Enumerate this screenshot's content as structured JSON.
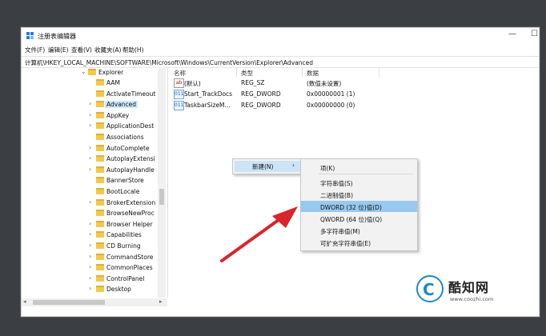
{
  "window": {
    "title": "注册表编辑器",
    "controls": {
      "minimize": "—",
      "maximize": "☐"
    }
  },
  "menubar": [
    "文件(F)",
    "编辑(E)",
    "查看(V)",
    "收藏夹(A)",
    "帮助(H)"
  ],
  "address": "计算机\\HKEY_LOCAL_MACHINE\\SOFTWARE\\Microsoft\\Windows\\CurrentVersion\\Explorer\\Advanced",
  "tree": {
    "parent": "Explorer",
    "items": [
      {
        "label": "AAM",
        "expandable": false
      },
      {
        "label": "ActivateTimeout",
        "expandable": false
      },
      {
        "label": "Advanced",
        "expandable": true,
        "selected": true
      },
      {
        "label": "AppKey",
        "expandable": true
      },
      {
        "label": "ApplicationDest",
        "expandable": true
      },
      {
        "label": "Associations",
        "expandable": false
      },
      {
        "label": "AutoComplete",
        "expandable": true
      },
      {
        "label": "AutoplayExtensi",
        "expandable": true
      },
      {
        "label": "AutoplayHandle",
        "expandable": true
      },
      {
        "label": "BannerStore",
        "expandable": false
      },
      {
        "label": "BootLocale",
        "expandable": false
      },
      {
        "label": "BrokerExtension",
        "expandable": true
      },
      {
        "label": "BrowseNewProc",
        "expandable": false
      },
      {
        "label": "Browser Helper",
        "expandable": true
      },
      {
        "label": "Capabilities",
        "expandable": true
      },
      {
        "label": "CD Burning",
        "expandable": true
      },
      {
        "label": "CommandStore",
        "expandable": true
      },
      {
        "label": "CommonPlaces",
        "expandable": true
      },
      {
        "label": "ControlPanel",
        "expandable": true
      },
      {
        "label": "Desktop",
        "expandable": true
      }
    ]
  },
  "list": {
    "headers": {
      "name": "名称",
      "type": "类型",
      "data": "数据"
    },
    "rows": [
      {
        "icon": "ab",
        "name": "(默认)",
        "type": "REG_SZ",
        "data": "(数值未设置)"
      },
      {
        "icon": "bin",
        "name": "Start_TrackDocs",
        "type": "REG_DWORD",
        "data": "0x00000001 (1)"
      },
      {
        "icon": "bin",
        "name": "TaskbarSizeM...",
        "type": "REG_DWORD",
        "data": "0x00000000 (0)"
      }
    ]
  },
  "context_menu": {
    "new_label": "新建(N)",
    "arrow": "›",
    "submenu": [
      {
        "label": "项(K)"
      },
      {
        "label": "字符串值(S)"
      },
      {
        "label": "二进制值(B)"
      },
      {
        "label": "DWORD (32 位)值(D)",
        "highlighted": true
      },
      {
        "label": "QWORD (64 位)值(Q)"
      },
      {
        "label": "多字符串值(M)"
      },
      {
        "label": "可扩充字符串值(E)"
      }
    ]
  },
  "watermark": {
    "logo_letter": "C",
    "name": "酷知网",
    "url": "www.coozhi.com"
  },
  "colors": {
    "highlight": "#99c9ef",
    "selection": "#cce8ff",
    "arrow": "#d9242b",
    "watermark_blue": "#1e88c8"
  }
}
